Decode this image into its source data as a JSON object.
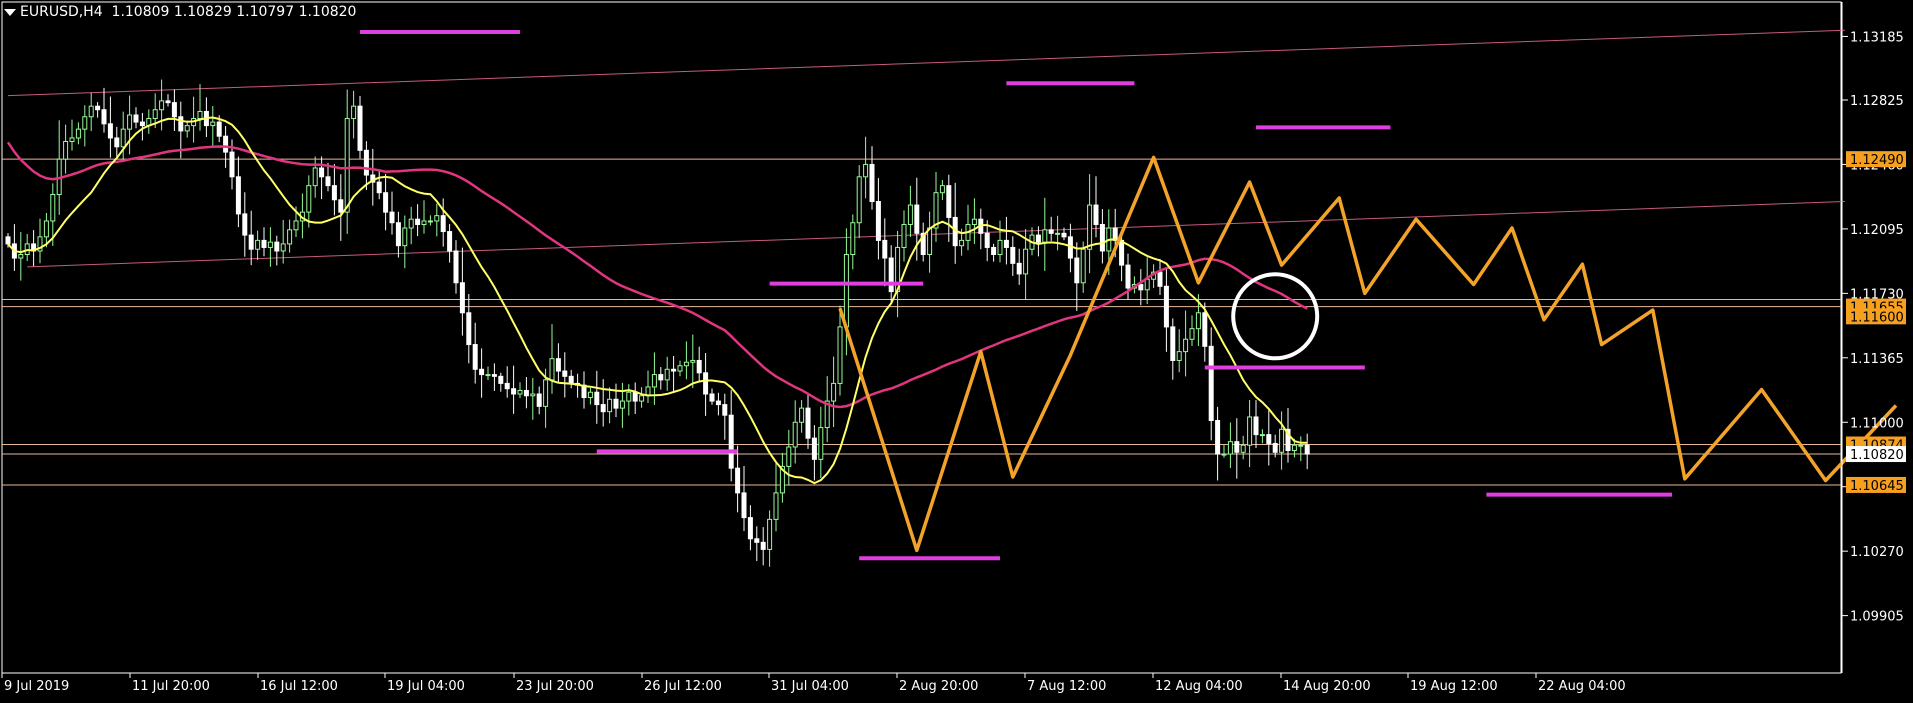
{
  "header": {
    "symbol": "EURUSD,H4",
    "ohlc": "1.10809 1.10829 1.10797 1.10820"
  },
  "colors": {
    "background": "#000000",
    "axis": "#ffffff",
    "candle_bull": "#98fb98",
    "candle_bear": "#ffffff",
    "ma_fast": "#ffff66",
    "ma_slow": "#e0357f",
    "zigzag": "#f4a32a",
    "support_resistance_marks": "#e03ee0",
    "hline": "#e8b998",
    "trendline": "#c75a7e",
    "price_label_bg": "#f7a01f",
    "current_price_bg": "#ffffff"
  },
  "chart_data": {
    "type": "candlestick",
    "symbol": "EURUSD",
    "timeframe": "H4",
    "ylim": [
      1.0958,
      1.1338
    ],
    "y_ticks": [
      "1.13185",
      "1.12825",
      "1.12460",
      "1.12095",
      "1.11730",
      "1.11365",
      "1.11000",
      "1.10635",
      "1.10270",
      "1.09905"
    ],
    "x_ticks": [
      "9 Jul 2019",
      "11 Jul 20:00",
      "16 Jul 12:00",
      "19 Jul 04:00",
      "23 Jul 20:00",
      "26 Jul 12:00",
      "31 Jul 04:00",
      "2 Aug 20:00",
      "7 Aug 12:00",
      "12 Aug 04:00",
      "14 Aug 20:00",
      "19 Aug 12:00",
      "22 Aug 04:00"
    ],
    "price_labels": [
      {
        "text": "1.12490",
        "value": 1.1249,
        "style": "level"
      },
      {
        "text": "1.11655",
        "value": 1.11655,
        "style": "level"
      },
      {
        "text": "1.11600",
        "value": 1.116,
        "style": "level-hidden"
      },
      {
        "text": "1.10874",
        "value": 1.10874,
        "style": "level"
      },
      {
        "text": "1.10820",
        "value": 1.1082,
        "style": "current"
      },
      {
        "text": "1.10645",
        "value": 1.10645,
        "style": "level"
      }
    ],
    "horizontal_levels": [
      1.1249,
      1.11695,
      1.11655,
      1.10874,
      1.1082,
      1.10645
    ],
    "trendlines": [
      {
        "from": [
          0,
          1.1285
        ],
        "to": [
          287,
          1.1322
        ]
      },
      {
        "from": [
          3,
          1.1188
        ],
        "to": [
          287,
          1.1225
        ]
      }
    ],
    "candles_close": [
      1.1201,
      1.1193,
      1.1195,
      1.1201,
      1.1197,
      1.1205,
      1.1214,
      1.1229,
      1.1249,
      1.1259,
      1.1261,
      1.1266,
      1.1273,
      1.1279,
      1.1277,
      1.1269,
      1.1261,
      1.1256,
      1.1266,
      1.1274,
      1.127,
      1.1268,
      1.1272,
      1.1277,
      1.1282,
      1.1281,
      1.1273,
      1.1265,
      1.1268,
      1.1272,
      1.1276,
      1.1268,
      1.127,
      1.1262,
      1.1253,
      1.1239,
      1.1218,
      1.1206,
      1.1198,
      1.1203,
      1.1199,
      1.1202,
      1.1197,
      1.1201,
      1.1209,
      1.1214,
      1.1219,
      1.1234,
      1.1244,
      1.1239,
      1.1234,
      1.1226,
      1.1219,
      1.1272,
      1.1279,
      1.1254,
      1.124,
      1.1236,
      1.123,
      1.1219,
      1.1213,
      1.12,
      1.121,
      1.1215,
      1.1212,
      1.1214,
      1.1214,
      1.1217,
      1.1208,
      1.1197,
      1.1179,
      1.1162,
      1.1144,
      1.113,
      1.1127,
      1.1127,
      1.1126,
      1.1122,
      1.1119,
      1.1116,
      1.1118,
      1.1115,
      1.1116,
      1.1109,
      1.1124,
      1.1136,
      1.1129,
      1.1126,
      1.1122,
      1.1121,
      1.1114,
      1.1117,
      1.111,
      1.1106,
      1.1113,
      1.1108,
      1.1112,
      1.1117,
      1.1112,
      1.1115,
      1.112,
      1.1127,
      1.1124,
      1.113,
      1.1129,
      1.1132,
      1.1134,
      1.1135,
      1.1128,
      1.1116,
      1.1112,
      1.111,
      1.1104,
      1.1074,
      1.106,
      1.1046,
      1.1034,
      1.1032,
      1.1028,
      1.1045,
      1.106,
      1.1075,
      1.1086,
      1.11,
      1.1108,
      1.1091,
      1.1079,
      1.1097,
      1.1112,
      1.1122,
      1.1154,
      1.1195,
      1.1213,
      1.1239,
      1.1246,
      1.1225,
      1.1203,
      1.1193,
      1.1174,
      1.1199,
      1.1212,
      1.1223,
      1.1207,
      1.1195,
      1.121,
      1.123,
      1.1234,
      1.1216,
      1.12,
      1.1203,
      1.1212,
      1.1215,
      1.1207,
      1.1199,
      1.1195,
      1.1203,
      1.1199,
      1.119,
      1.1184,
      1.1198,
      1.1206,
      1.1202,
      1.1209,
      1.1207,
      1.1207,
      1.1205,
      1.1193,
      1.1179,
      1.1198,
      1.1223,
      1.1212,
      1.1197,
      1.121,
      1.1203,
      1.1189,
      1.1176,
      1.1178,
      1.1175,
      1.1181,
      1.1185,
      1.1177,
      1.1154,
      1.1135,
      1.114,
      1.1147,
      1.1153,
      1.1162,
      1.1143,
      1.1101,
      1.1082,
      1.1082,
      1.1089,
      1.1083,
      1.1087,
      1.1103,
      1.1093,
      1.1093,
      1.1088,
      1.1083,
      1.1096,
      1.1084,
      1.1087,
      1.1087,
      1.1082
    ],
    "ma_fast_label": "",
    "ma_slow_label": "",
    "zigzag_points": [
      [
        130,
        1.11645
      ],
      [
        142,
        1.10275
      ],
      [
        152,
        1.114
      ],
      [
        157,
        1.1069
      ],
      [
        166,
        1.1138
      ],
      [
        179,
        1.125
      ],
      [
        186,
        1.1179
      ],
      [
        194,
        1.1236
      ],
      [
        199,
        1.1189
      ],
      [
        208,
        1.1227
      ],
      [
        212,
        1.1173
      ],
      [
        220,
        1.1215
      ],
      [
        229,
        1.1178
      ],
      [
        235,
        1.121
      ],
      [
        240,
        1.1158
      ],
      [
        246,
        1.11895
      ],
      [
        249,
        1.1144
      ],
      [
        257,
        1.11635
      ],
      [
        262,
        1.1068
      ],
      [
        274,
        1.11185
      ],
      [
        284,
        1.1067
      ],
      [
        295,
        1.11095
      ]
    ],
    "marks": [
      {
        "kind": "horizontal-dash",
        "price": 1.1321,
        "from": 55,
        "to": 80
      },
      {
        "kind": "horizontal-dash",
        "price": 1.1292,
        "from": 156,
        "to": 176
      },
      {
        "kind": "horizontal-dash",
        "price": 1.1267,
        "from": 195,
        "to": 216
      },
      {
        "kind": "horizontal-dash",
        "price": 1.11785,
        "from": 119,
        "to": 143
      },
      {
        "kind": "horizontal-dash",
        "price": 1.1131,
        "from": 187,
        "to": 212
      },
      {
        "kind": "horizontal-dash",
        "price": 1.10835,
        "from": 92,
        "to": 114
      },
      {
        "kind": "horizontal-dash",
        "price": 1.1059,
        "from": 231,
        "to": 260
      },
      {
        "kind": "horizontal-dash",
        "price": 1.1023,
        "from": 133,
        "to": 155
      }
    ],
    "circle_mark": {
      "bar": 198,
      "price": 1.116
    },
    "grid": false
  }
}
